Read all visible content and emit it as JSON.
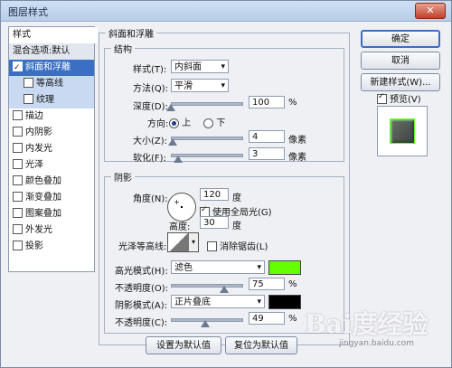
{
  "window": {
    "title": "图层样式",
    "close_icon": "close-icon"
  },
  "sidebar": {
    "header": "样式",
    "blend": "混合选项:默认",
    "items": [
      {
        "label": "斜面和浮雕",
        "checked": true
      },
      {
        "label": "等高线",
        "checked": false
      },
      {
        "label": "纹理",
        "checked": false
      },
      {
        "label": "描边",
        "checked": false
      },
      {
        "label": "内阴影",
        "checked": false
      },
      {
        "label": "内发光",
        "checked": false
      },
      {
        "label": "光泽",
        "checked": false
      },
      {
        "label": "颜色叠加",
        "checked": false
      },
      {
        "label": "渐变叠加",
        "checked": false
      },
      {
        "label": "图案叠加",
        "checked": false
      },
      {
        "label": "外发光",
        "checked": false
      },
      {
        "label": "投影",
        "checked": false
      }
    ]
  },
  "bevel": {
    "group_title": "斜面和浮雕",
    "structure_title": "结构",
    "style_label": "样式(T):",
    "style_value": "内斜面",
    "method_label": "方法(Q):",
    "method_value": "平滑",
    "depth_label": "深度(D):",
    "depth_value": "100",
    "depth_level": 0.0,
    "percent": "%",
    "direction_label": "方向:",
    "dir_up": "上",
    "dir_down": "下",
    "size_label": "大小(Z):",
    "size_value": "4",
    "size_level": 0.02,
    "px": "像素",
    "soften_label": "软化(F):",
    "soften_value": "3",
    "soften_level": 0.1
  },
  "shading": {
    "title": "阴影",
    "angle_label": "角度(N):",
    "angle_value": "120",
    "deg": "度",
    "global_light": "使用全局光(G)",
    "altitude_label": "高度:",
    "altitude_value": "30",
    "gloss_label": "光泽等高线:",
    "antialias": "消除锯齿(L)",
    "highlight_mode_label": "高光模式(H):",
    "highlight_mode_value": "滤色",
    "highlight_color": "#66ff00",
    "opacity1_label": "不透明度(O):",
    "opacity1_value": "75",
    "opacity1_level": 0.75,
    "shadow_mode_label": "阴影模式(A):",
    "shadow_mode_value": "正片叠底",
    "shadow_color": "#000000",
    "opacity2_label": "不透明度(C):",
    "opacity2_value": "49",
    "opacity2_level": 0.49,
    "percent": "%"
  },
  "footer": {
    "make_default": "设置为默认值",
    "reset_default": "复位为默认值"
  },
  "right": {
    "ok": "确定",
    "cancel": "取消",
    "new_style": "新建样式(W)...",
    "preview": "预览(V)"
  },
  "watermark": {
    "logo": "Bai度经验",
    "url": "jingyan.baidu.com"
  }
}
